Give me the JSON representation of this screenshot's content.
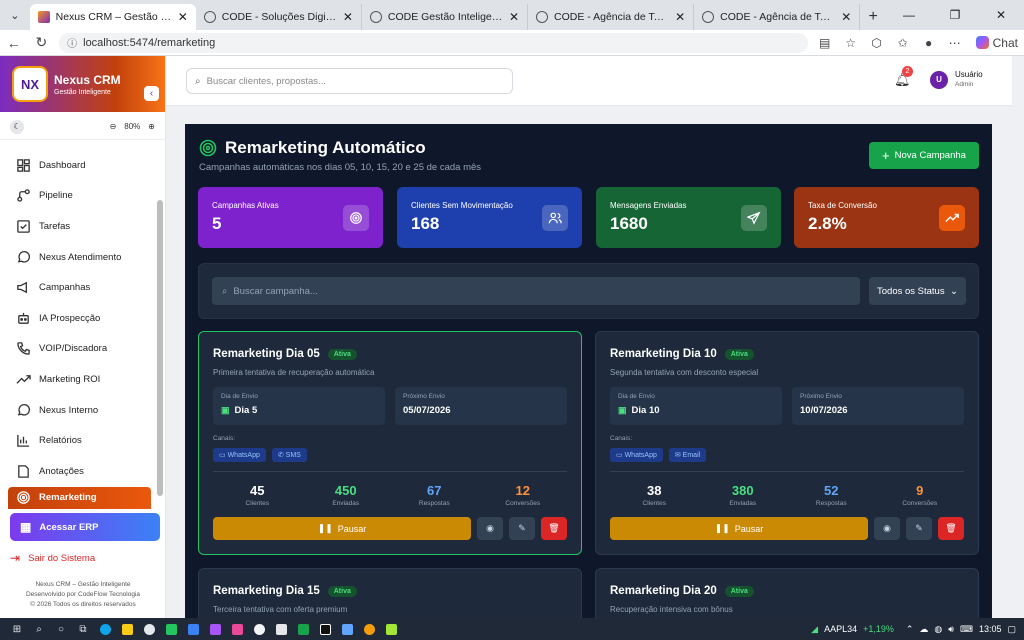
{
  "browser": {
    "tabs": [
      {
        "title": "Nexus CRM – Gestão Inteligente",
        "active": true
      },
      {
        "title": "CODE - Soluções Digitais Profissio",
        "active": false
      },
      {
        "title": "CODE Gestão Inteligente | Transfo",
        "active": false
      },
      {
        "title": "CODE - Agência de Tecnologia Em",
        "active": false
      },
      {
        "title": "CODE - Agência de Tecnologia Em",
        "active": false
      }
    ],
    "url": "localhost:5474/remarketing",
    "chat_label": "Chat"
  },
  "sidebar": {
    "logo_text": "NX",
    "brand_name": "Nexus CRM",
    "brand_sub": "Gestão Inteligente",
    "zoom": "80%",
    "items": [
      {
        "label": "Dashboard",
        "icon": "dashboard-icon"
      },
      {
        "label": "Pipeline",
        "icon": "pipeline-icon"
      },
      {
        "label": "Tarefas",
        "icon": "checkbox-icon"
      },
      {
        "label": "Nexus Atendimento",
        "icon": "chat-icon"
      },
      {
        "label": "Campanhas",
        "icon": "megaphone-icon"
      },
      {
        "label": "IA Prospecção",
        "icon": "bot-icon"
      },
      {
        "label": "VOIP/Discadora",
        "icon": "phone-icon"
      },
      {
        "label": "Marketing ROI",
        "icon": "trending-up-icon"
      },
      {
        "label": "Nexus Interno",
        "icon": "chat-icon"
      },
      {
        "label": "Relatórios",
        "icon": "bar-chart-icon"
      },
      {
        "label": "Anotações",
        "icon": "note-icon"
      },
      {
        "label": "Remarketing",
        "icon": "target-icon",
        "active": true
      }
    ],
    "erp_label": "Acessar ERP",
    "logout_label": "Sair do Sistema",
    "footer": [
      "Nexus CRM – Gestão Inteligente",
      "Desenvolvido por CodeFlow Tecnologia",
      "© 2026 Todos os direitos reservados"
    ]
  },
  "topbar": {
    "search_placeholder": "Buscar clientes, propostas...",
    "notif_count": "2",
    "user_initial": "U",
    "user_name": "Usuário",
    "user_role": "Admin"
  },
  "page": {
    "title": "Remarketing Automático",
    "subtitle": "Campanhas automáticas nos dias 05, 10, 15, 20 e 25 de cada mês",
    "new_button": "Nova Campanha",
    "stats": [
      {
        "label": "Campanhas Ativas",
        "value": "5",
        "color": "#7e22ce",
        "icon": "target-icon"
      },
      {
        "label": "Clientes Sem Movimentação",
        "value": "168",
        "color": "#1e40af",
        "icon": "users-icon"
      },
      {
        "label": "Mensagens Enviadas",
        "value": "1680",
        "color": "#166534",
        "icon": "send-icon"
      },
      {
        "label": "Taxa de Conversão",
        "value": "2.8%",
        "color": "#9a3412",
        "icon": "trending-up-icon"
      }
    ],
    "search_placeholder": "Buscar campanha...",
    "status_filter": "Todos os Status",
    "labels": {
      "day": "Dia de Envio",
      "next": "Próximo Envio",
      "channels": "Canais:",
      "clients": "Clientes",
      "sent": "Enviadas",
      "replies": "Respostas",
      "conversions": "Conversões",
      "pause": "Pausar"
    },
    "campaigns": [
      {
        "name": "Remarketing Dia 05",
        "status": "Ativa",
        "desc": "Primeira tentativa de recuperação automática",
        "day": "Dia 5",
        "next": "05/07/2026",
        "channels": [
          "WhatsApp",
          "SMS"
        ],
        "clients": "45",
        "sent": "450",
        "replies": "67",
        "conversions": "12"
      },
      {
        "name": "Remarketing Dia 10",
        "status": "Ativa",
        "desc": "Segunda tentativa com desconto especial",
        "day": "Dia 10",
        "next": "10/07/2026",
        "channels": [
          "WhatsApp",
          "Email"
        ],
        "clients": "38",
        "sent": "380",
        "replies": "52",
        "conversions": "9"
      },
      {
        "name": "Remarketing Dia 15",
        "status": "Ativa",
        "desc": "Terceira tentativa com oferta premium"
      },
      {
        "name": "Remarketing Dia 20",
        "status": "Ativa",
        "desc": "Recuperação intensiva com bônus"
      }
    ]
  },
  "taskbar": {
    "ticker_symbol": "AAPL34",
    "ticker_change": "+1,19%",
    "time": "13:05"
  }
}
